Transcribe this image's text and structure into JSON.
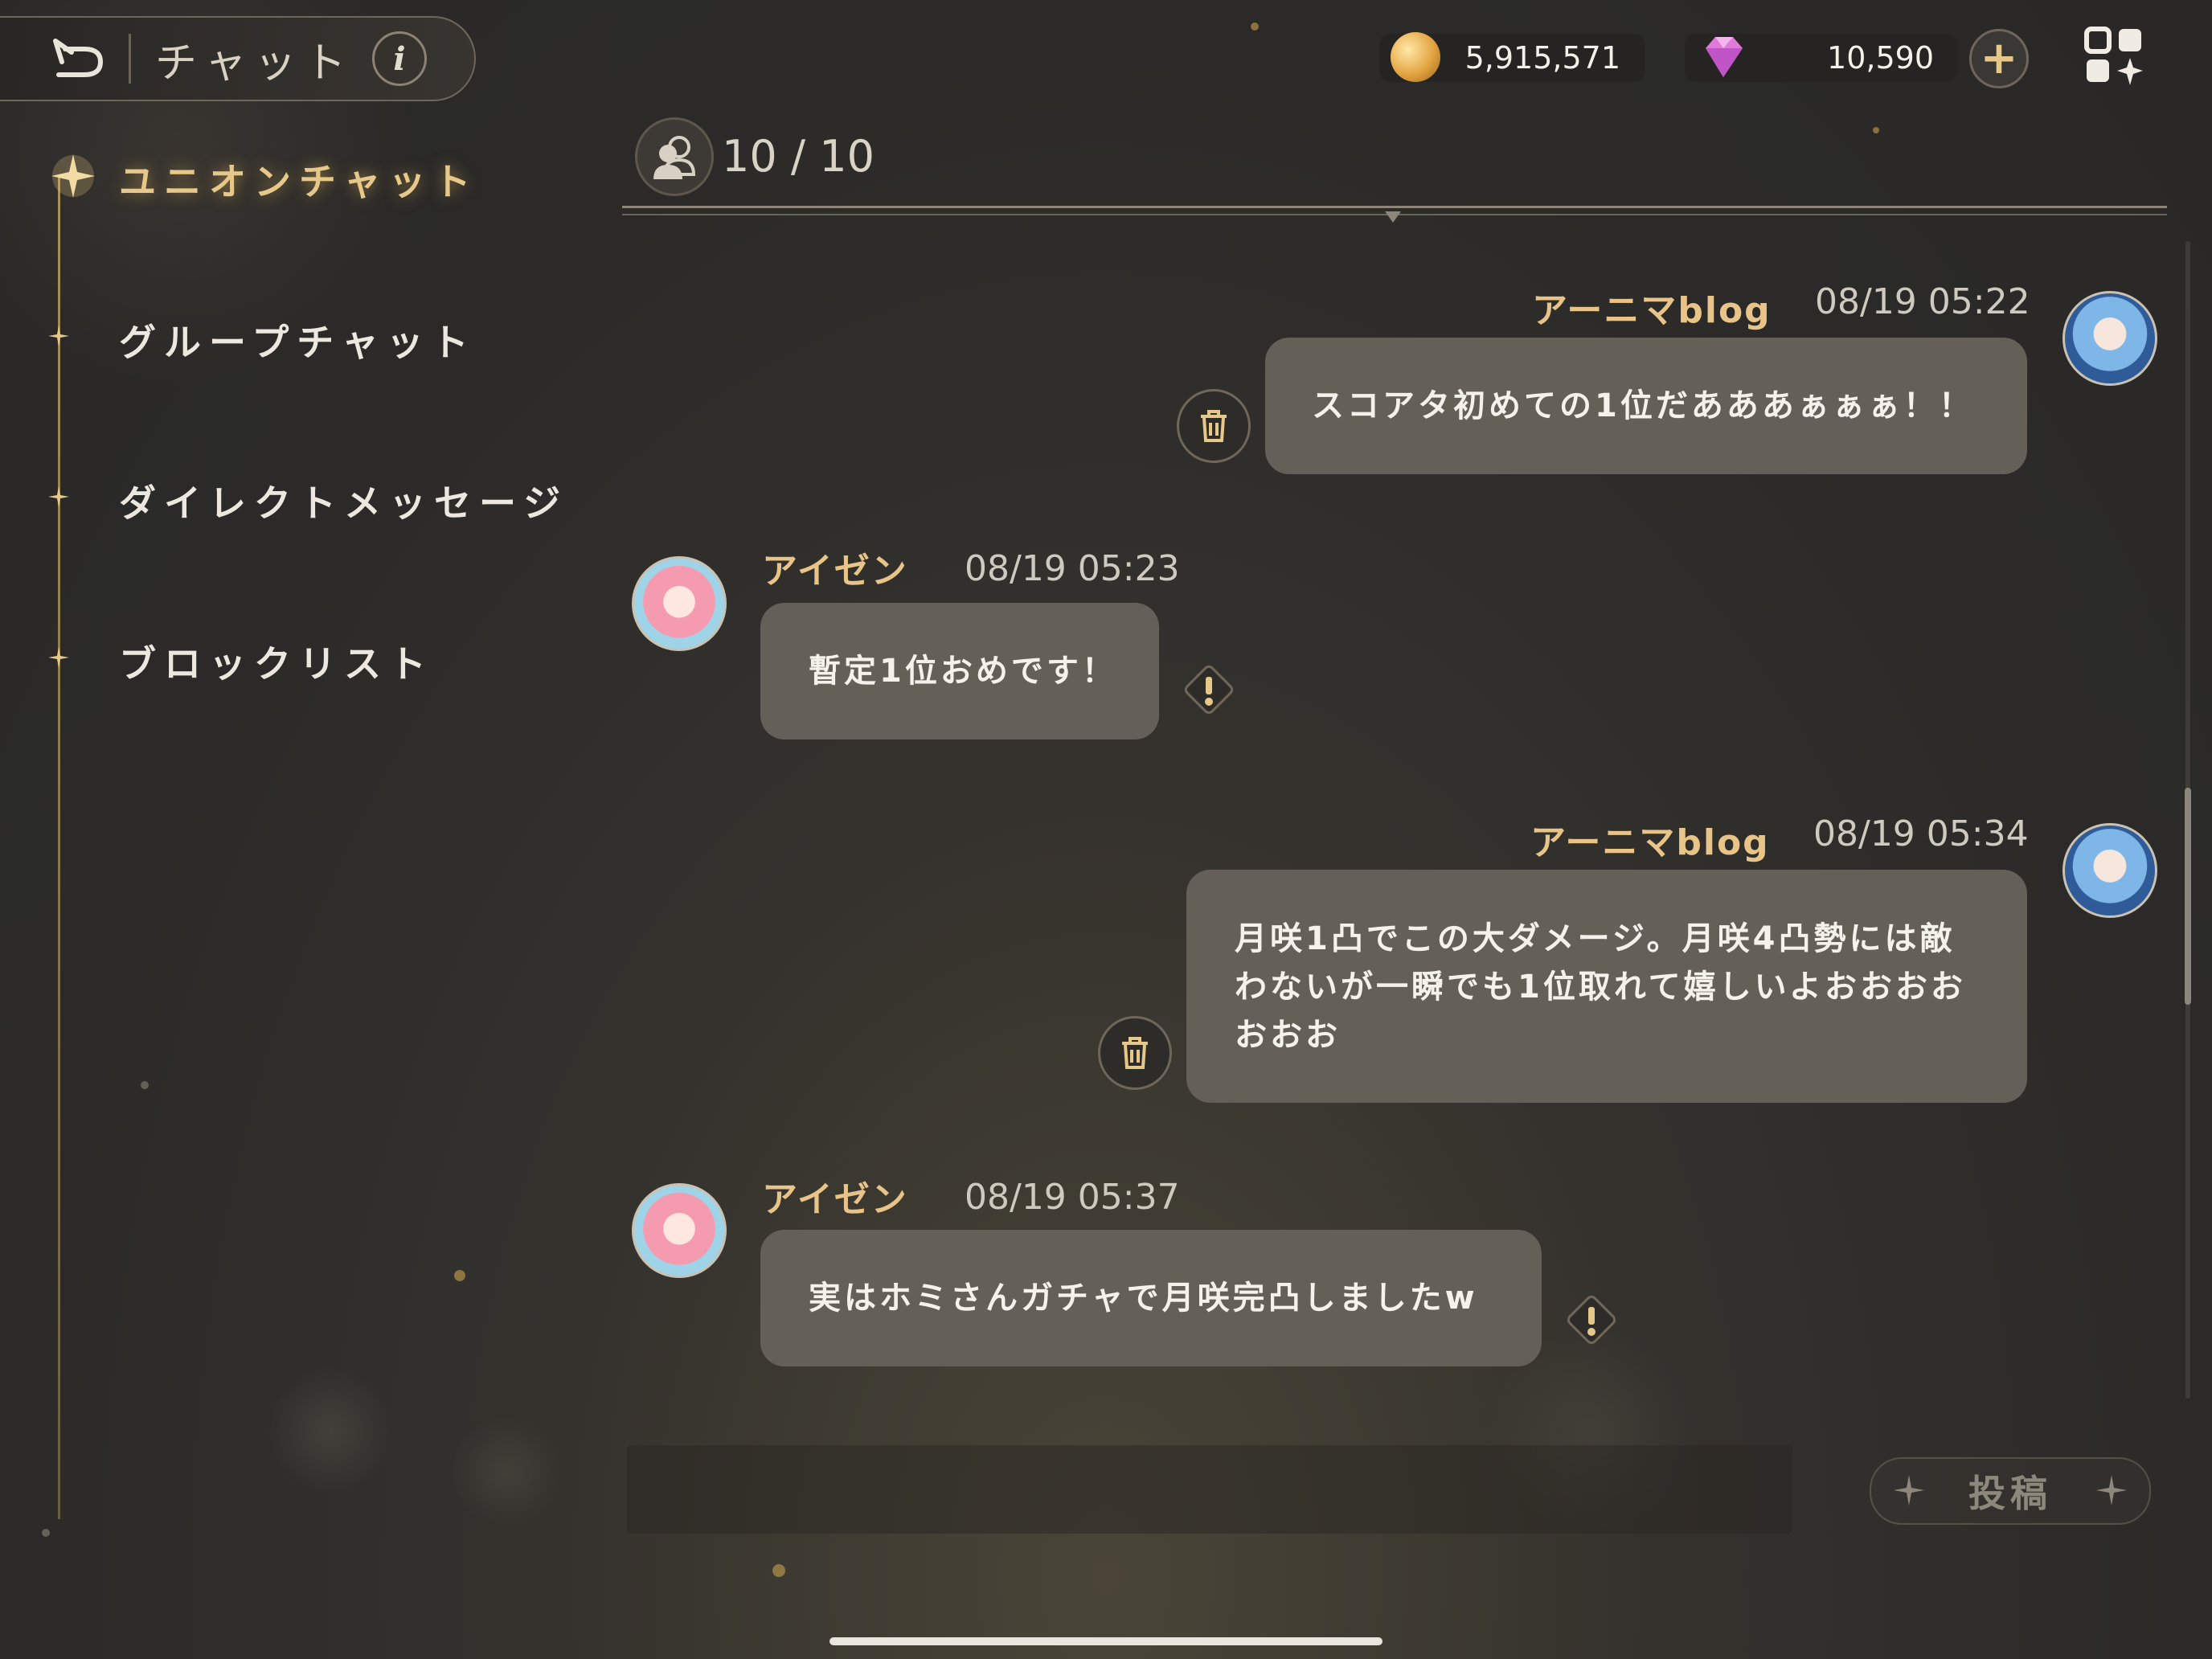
{
  "header": {
    "title": "チャット",
    "info_label": "i",
    "coins": "5,915,571",
    "gems": "10,590",
    "plus_label": "+"
  },
  "sidebar": {
    "items": [
      {
        "label": "ユニオンチャット",
        "active": true
      },
      {
        "label": "グループチャット",
        "active": false
      },
      {
        "label": "ダイレクトメッセージ",
        "active": false
      },
      {
        "label": "ブロックリスト",
        "active": false
      }
    ]
  },
  "chat": {
    "member_count": "10 / 10",
    "messages": [
      {
        "user": "アーニマblog",
        "time": "08/19 05:22",
        "text": "スコアタ初めての1位だあああぁぁぁ！！",
        "own": true
      },
      {
        "user": "アイゼン",
        "time": "08/19 05:23",
        "text": "暫定1位おめです！",
        "own": false
      },
      {
        "user": "アーニマblog",
        "time": "08/19 05:34",
        "text_lines": [
          "月咲1凸でこの大ダメージ。月咲4凸勢には敵",
          "わないが一瞬でも1位取れて嬉しいよおおおお",
          "おおお"
        ],
        "own": true
      },
      {
        "user": "アイゼン",
        "time": "08/19 05:37",
        "text": "実はホミさんガチャで月咲完凸しましたw",
        "own": false
      }
    ]
  },
  "composer": {
    "input_value": "",
    "post_label": "投稿"
  },
  "colors": {
    "accent_gold": "#e6c98a",
    "bubble": "#646058",
    "background": "#2b2a28"
  },
  "icons": [
    "back-icon",
    "info-icon",
    "coin-icon",
    "gem-icon",
    "plus-icon",
    "menu-grid-icon",
    "members-icon",
    "trash-icon",
    "report-icon",
    "sparkle-icon"
  ]
}
